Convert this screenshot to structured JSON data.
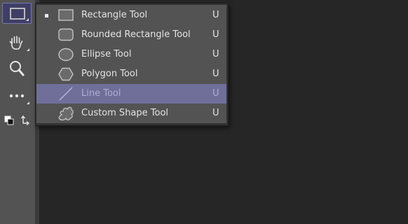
{
  "toolbar": {
    "tools": [
      {
        "name": "rectangle-tool-icon",
        "active": true
      },
      {
        "name": "hand-tool-icon",
        "active": false
      },
      {
        "name": "zoom-tool-icon",
        "active": false
      },
      {
        "name": "more-tools-icon",
        "active": false
      },
      {
        "name": "color-swatches-icon",
        "active": false
      }
    ],
    "active_color": "#3f3f66"
  },
  "flyout": {
    "items": [
      {
        "label": "Rectangle Tool",
        "shortcut": "U",
        "icon": "rectangle-icon",
        "selected": true,
        "highlighted": false
      },
      {
        "label": "Rounded Rectangle Tool",
        "shortcut": "U",
        "icon": "rounded-rectangle-icon",
        "selected": false,
        "highlighted": false
      },
      {
        "label": "Ellipse Tool",
        "shortcut": "U",
        "icon": "ellipse-icon",
        "selected": false,
        "highlighted": false
      },
      {
        "label": "Polygon Tool",
        "shortcut": "U",
        "icon": "polygon-icon",
        "selected": false,
        "highlighted": false
      },
      {
        "label": "Line Tool",
        "shortcut": "U",
        "icon": "line-icon",
        "selected": false,
        "highlighted": true
      },
      {
        "label": "Custom Shape Tool",
        "shortcut": "U",
        "icon": "custom-shape-icon",
        "selected": false,
        "highlighted": false
      }
    ],
    "highlight_color": "#6f6f9a"
  }
}
